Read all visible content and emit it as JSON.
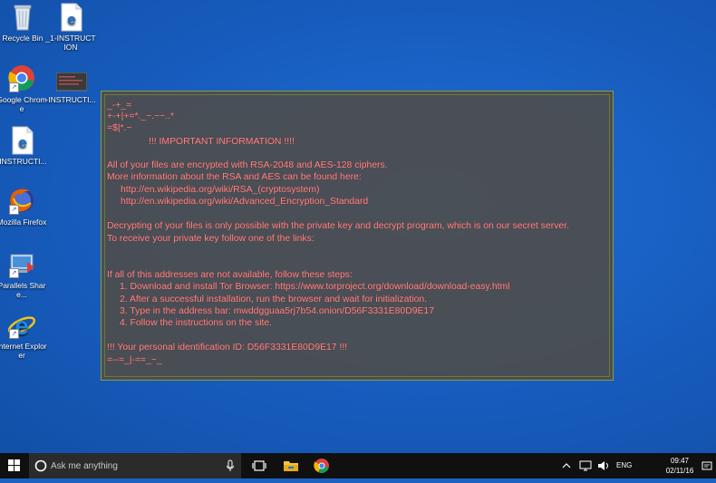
{
  "desktop_icons": [
    {
      "id": "recycle-bin",
      "label": "Recycle Bin"
    },
    {
      "id": "instruction-edge-1",
      "label": "_1-INSTRUCTION"
    },
    {
      "id": "chrome",
      "label": "Google Chrome"
    },
    {
      "id": "instruction-dark",
      "label": "-INSTRUCTI..."
    },
    {
      "id": "instruction-edge-2",
      "label": "-INSTRUCTI..."
    },
    {
      "id": "firefox",
      "label": "Mozilla Firefox"
    },
    {
      "id": "parallels",
      "label": "Parallels Share..."
    },
    {
      "id": "ie",
      "label": "Internet Explorer"
    }
  ],
  "note": {
    "lines": [
      "_-+_=",
      "+-+|+=*._~.~~..*",
      "=$|*.~",
      "!!! IMPORTANT INFORMATION !!!!",
      "All of your files are encrypted with RSA-2048 and AES-128 ciphers.",
      "More information about the RSA and AES can be found here:",
      "http://en.wikipedia.org/wiki/RSA_(cryptosystem)",
      "http://en.wikipedia.org/wiki/Advanced_Encryption_Standard",
      "Decrypting of your files is only possible with the private key and decrypt program, which is on our secret server.",
      "To receive your private key follow one of the links:",
      "If all of this addresses are not available, follow these steps:",
      "1. Download and install Tor Browser: https://www.torproject.org/download/download-easy.html",
      "2. After a successful installation, run the browser and wait for initialization.",
      "3. Type in the address bar: mwddgguaa5rj7b54.onion/D56F3331E80D9E17",
      "4. Follow the instructions on the site.",
      "!!! Your personal identification ID: D56F3331E80D9E17 !!!",
      "=--=_|-==_~_"
    ]
  },
  "taskbar": {
    "search_placeholder": "Ask me anything",
    "language": "ENG",
    "time": "09:47",
    "date": "02/11/16"
  },
  "colors": {
    "desktop": "#1b62c2",
    "note_text": "#ff8585",
    "note_bg": "#4e4e4e"
  }
}
